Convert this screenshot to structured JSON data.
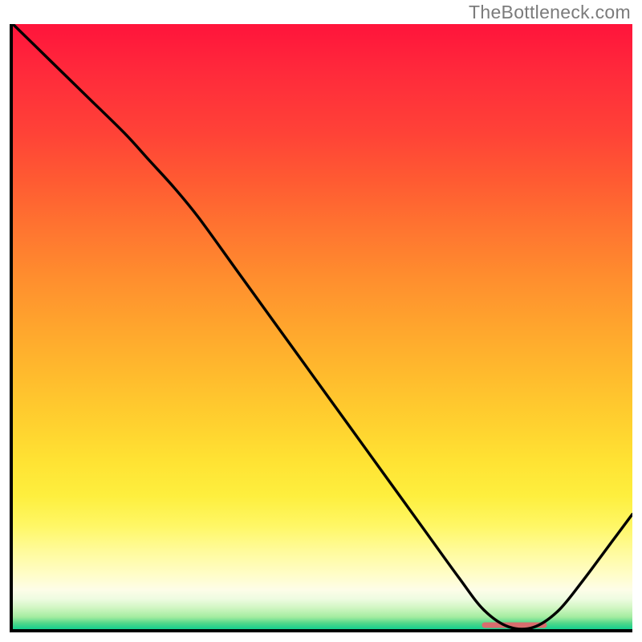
{
  "attribution": "TheBottleneck.com",
  "chart_data": {
    "type": "line",
    "title": "",
    "xlabel": "",
    "ylabel": "",
    "xlim": [
      0,
      100
    ],
    "ylim": [
      0,
      100
    ],
    "note": "No numeric axis ticks are visible; x/y are normalized 0–100. The single black curve descends from top-left, reaches ~0 near x≈80, then rises moderately toward x=100.",
    "series": [
      {
        "name": "curve",
        "x": [
          0,
          6,
          12,
          18,
          22,
          26,
          30,
          36,
          42,
          48,
          54,
          60,
          66,
          72,
          76,
          80,
          84,
          88,
          92,
          96,
          100
        ],
        "y": [
          100,
          94,
          88,
          82,
          77.5,
          73,
          68,
          59.5,
          51,
          42.5,
          34,
          25.5,
          17,
          8.5,
          3.2,
          0.4,
          0.3,
          3.0,
          8.0,
          13.5,
          19
        ]
      }
    ],
    "marker": {
      "x_center": 81,
      "y": 0.6,
      "width_pct": 10.5
    },
    "gradient_colors": {
      "top": "#ff143b",
      "mid_upper": "#ff8e2e",
      "mid": "#ffe233",
      "mid_lower": "#fffb9a",
      "bottom": "#14cf8e"
    }
  }
}
